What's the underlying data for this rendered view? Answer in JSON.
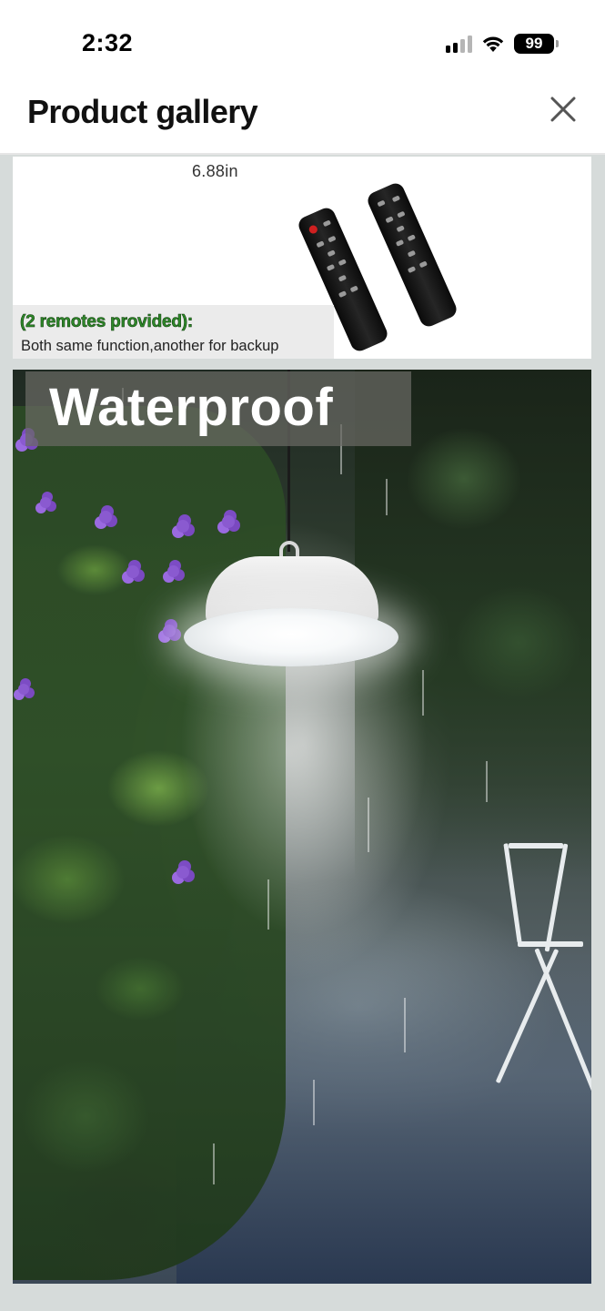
{
  "status_bar": {
    "time": "2:32",
    "battery_level": "99",
    "signal_bars_active": 2,
    "signal_bars_total": 4
  },
  "header": {
    "title": "Product gallery",
    "close_icon": "close-icon"
  },
  "gallery": {
    "images": [
      {
        "dimension_label": "6.88in",
        "highlight_caption": "(2 remotes provided):",
        "caption": "Both same function,another for backup"
      },
      {
        "overlay_title": "Waterproof"
      }
    ]
  },
  "colors": {
    "caption_green": "#2f8a2a",
    "gallery_background": "#d6dbda",
    "title_overlay": "#696964"
  }
}
